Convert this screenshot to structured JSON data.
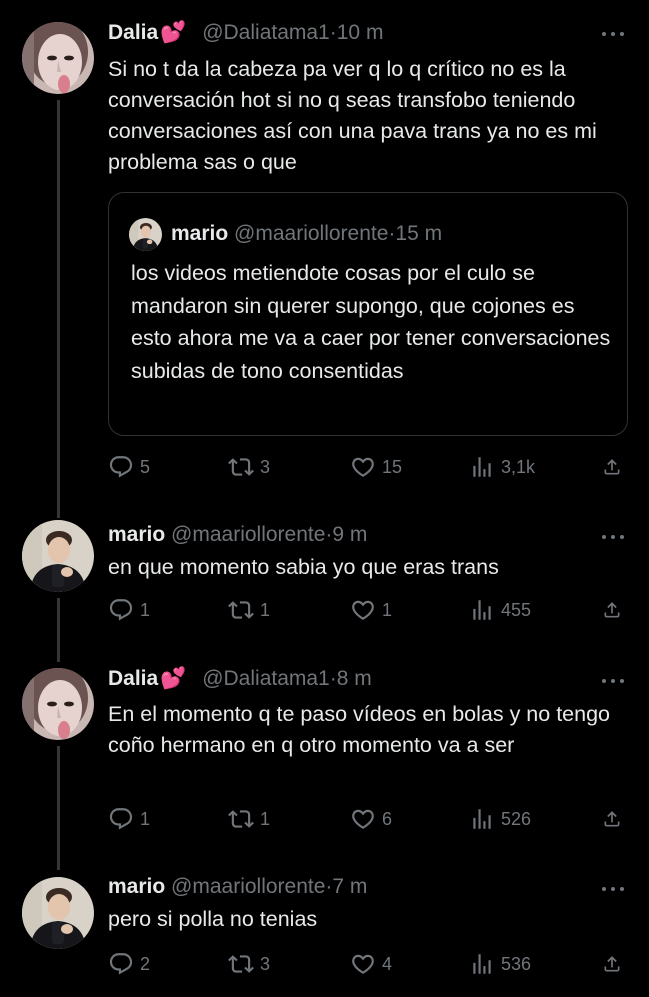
{
  "thread": [
    {
      "name": "Dalia",
      "emoji": "💕",
      "handle": "@Daliatama1",
      "dot": "·",
      "time": "10 m",
      "text": "Si no t da la cabeza pa ver q lo q crítico no es la conversación hot si no q seas transfobo teniendo conversaciones así con una pava trans ya no es mi problema sas o que",
      "quote": {
        "name": "mario",
        "handle": "@maariollorente",
        "dot": "·",
        "time": "15 m",
        "text": "los videos metiendote cosas por el culo se mandaron sin querer supongo, que cojones es esto ahora me va a caer por tener conversaciones subidas de tono consentidas"
      },
      "replies": "5",
      "retweets": "3",
      "likes": "15",
      "views": "3,1k"
    },
    {
      "name": "mario",
      "emoji": "",
      "handle": "@maariollorente",
      "dot": "·",
      "time": "9 m",
      "text": "en que momento sabia yo que eras trans",
      "replies": "1",
      "retweets": "1",
      "likes": "1",
      "views": "455"
    },
    {
      "name": "Dalia",
      "emoji": "💕",
      "handle": "@Daliatama1",
      "dot": "·",
      "time": "8 m",
      "text": "En el momento q te paso vídeos en bolas y no tengo coño hermano en q otro momento va a ser",
      "replies": "1",
      "retweets": "1",
      "likes": "6",
      "views": "526"
    },
    {
      "name": "mario",
      "emoji": "",
      "handle": "@maariollorente",
      "dot": "·",
      "time": "7 m",
      "text": "pero si polla no tenias",
      "replies": "2",
      "retweets": "3",
      "likes": "4",
      "views": "536"
    }
  ],
  "icons": {
    "reply": "reply-icon",
    "retweet": "retweet-icon",
    "like": "heart-icon",
    "views": "views-icon",
    "share": "share-icon",
    "more": "more-icon"
  },
  "colors": {
    "background": "#000000",
    "text": "#e7e9ea",
    "secondary": "#71767b",
    "border": "#2f3336"
  }
}
